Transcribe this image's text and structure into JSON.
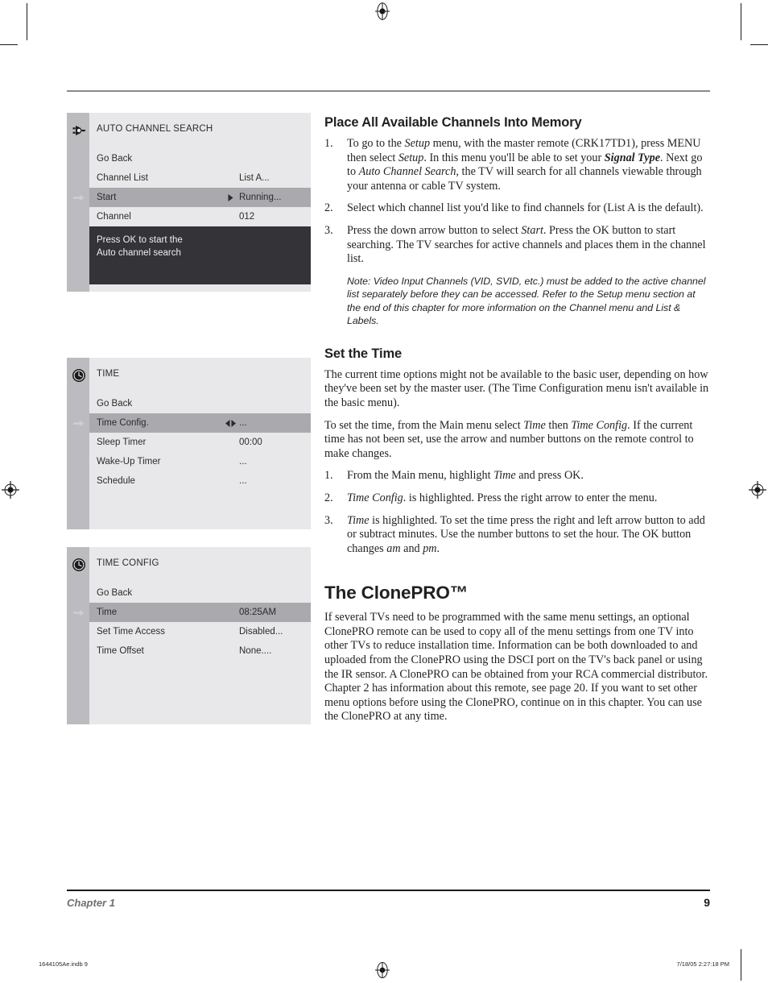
{
  "menus": [
    {
      "icon": "antenna-signal-icon",
      "title": "AUTO CHANNEL SEARCH",
      "rows": [
        {
          "label": "Go Back",
          "value": "",
          "arrows": "",
          "highlighted": false
        },
        {
          "label": "Channel List",
          "value": "List A...",
          "arrows": "",
          "highlighted": false
        },
        {
          "label": "Start",
          "value": "Running...",
          "arrows": "right",
          "highlighted": true
        },
        {
          "label": "Channel",
          "value": "012",
          "arrows": "",
          "highlighted": false
        }
      ],
      "help": [
        "Press OK to start the",
        "Auto channel search"
      ]
    },
    {
      "icon": "clock-icon",
      "title": "TIME",
      "rows": [
        {
          "label": "Go Back",
          "value": "",
          "arrows": "",
          "highlighted": false
        },
        {
          "label": "Time Config.",
          "value": "...",
          "arrows": "both",
          "highlighted": true
        },
        {
          "label": "Sleep Timer",
          "value": "00:00",
          "arrows": "",
          "highlighted": false
        },
        {
          "label": "Wake-Up Timer",
          "value": "...",
          "arrows": "",
          "highlighted": false
        },
        {
          "label": "Schedule",
          "value": "...",
          "arrows": "",
          "highlighted": false
        }
      ],
      "help": []
    },
    {
      "icon": "clock-icon",
      "title": "TIME CONFIG",
      "rows": [
        {
          "label": "Go Back",
          "value": "",
          "arrows": "",
          "highlighted": false
        },
        {
          "label": "Time",
          "value": "08:25AM",
          "arrows": "",
          "highlighted": true
        },
        {
          "label": "Set Time Access",
          "value": "Disabled...",
          "arrows": "",
          "highlighted": false
        },
        {
          "label": "Time Offset",
          "value": "None....",
          "arrows": "",
          "highlighted": false
        }
      ],
      "help": []
    }
  ],
  "sections": {
    "channels": {
      "heading": "Place All Available Channels Into Memory",
      "steps": {
        "one_num": "1.",
        "one_a": "To go to the ",
        "one_setup1": "Setup",
        "one_b": " menu, with the master remote (CRK17TD1), press MENU then select ",
        "one_setup2": "Setup",
        "one_c": ". In this menu you'll be able to set your ",
        "one_signaltype": "Signal Type",
        "one_d": ". Next go to ",
        "one_acs": "Auto Channel Search,",
        "one_e": " the TV will search for all channels viewable through your antenna or cable TV system.",
        "two_num": "2.",
        "two_text": "Select which channel list you'd like to find channels for (List A is the default).",
        "three_num": "3.",
        "three_a": "Press the down arrow button to select ",
        "three_start": "Start",
        "three_b": ". Press the OK button to start searching. The TV searches for active channels and places them in the channel list."
      },
      "note": "Note: Video Input Channels (VID, SVID, etc.) must be added to the active channel list separately before they can be accessed. Refer to the Setup menu section at the end of this chapter for more information on the Channel menu and List & Labels."
    },
    "time": {
      "heading": "Set the Time",
      "para1": "The current time options might not be available to the basic user, depending on how they've been set by the master user. (The Time Configuration menu isn't available in the basic menu).",
      "para2_a": "To set the time, from the Main menu select ",
      "para2_time": "Time",
      "para2_b": " then ",
      "para2_tc": "Time Config",
      "para2_c": ". If the current time has not been set, use the arrow and number buttons on the remote control to make changes.",
      "steps": {
        "one_num": "1.",
        "one_a": "From the Main menu, highlight ",
        "one_time": "Time",
        "one_b": " and press OK.",
        "two_num": "2.",
        "two_tc": "Time Config",
        "two_b": ". is highlighted. Press the right arrow to enter the menu.",
        "three_num": "3.",
        "three_time": "Time",
        "three_a": " is highlighted. To set the time press the right and left arrow button to add or subtract minutes. Use the number buttons to set the hour. The OK button changes ",
        "three_am": "am",
        "three_b": " and ",
        "three_pm": "pm",
        "three_c": "."
      }
    },
    "clonepro": {
      "heading": "The ClonePRO™",
      "para": "If several TVs need to be programmed with the same menu settings, an optional ClonePRO remote can be used to copy all of the menu settings from one TV into other TVs to reduce installation time. Information can be both downloaded to and uploaded from the ClonePRO using the DSCI port on the TV's back panel or using the IR sensor. A ClonePRO can be obtained from your RCA commercial distributor. Chapter 2 has information about this remote, see page 20. If you want to set other menu options before using the ClonePRO, continue on in this chapter. You can use the ClonePRO at any time."
    }
  },
  "footer": {
    "chapter": "Chapter 1",
    "page_number": "9"
  },
  "print_footer": {
    "file": "1644105Ae.indb   9",
    "timestamp": "7/18/05   2:27:18 PM"
  },
  "colors": {
    "osd_background": "#e8e8ea",
    "osd_rail": "#bcbcc0",
    "osd_highlight": "#aaaaae",
    "osd_help_background": "#333338",
    "text": "#231f20",
    "footer_chapter": "#6f6f6f"
  }
}
